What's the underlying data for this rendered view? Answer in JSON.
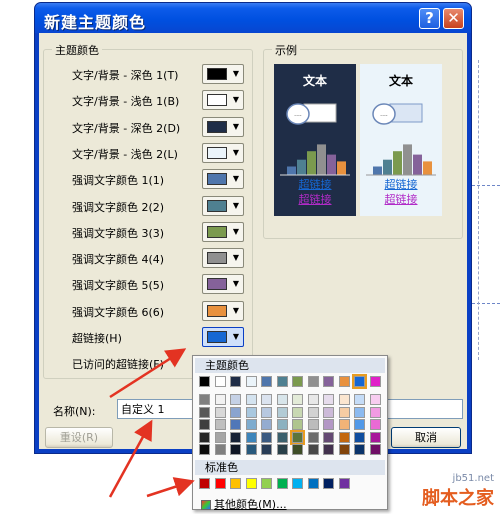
{
  "window": {
    "title": "新建主题颜色",
    "help_glyph": "?",
    "close_glyph": "✕"
  },
  "theme_colors": {
    "group_label": "主题颜色",
    "rows": [
      {
        "label": "文字/背景 - 深色 1(T)",
        "color": "#000000"
      },
      {
        "label": "文字/背景 - 浅色 1(B)",
        "color": "#ffffff"
      },
      {
        "label": "文字/背景 - 深色 2(D)",
        "color": "#1f2d47"
      },
      {
        "label": "文字/背景 - 浅色 2(L)",
        "color": "#ebf4fa"
      },
      {
        "label": "强调文字颜色 1(1)",
        "color": "#4f76ac"
      },
      {
        "label": "强调文字颜色 2(2)",
        "color": "#4f8091"
      },
      {
        "label": "强调文字颜色 3(3)",
        "color": "#7b9a4e"
      },
      {
        "label": "强调文字颜色 4(4)",
        "color": "#909090"
      },
      {
        "label": "强调文字颜色 5(5)",
        "color": "#85629a"
      },
      {
        "label": "强调文字颜色 6(6)",
        "color": "#e8913e"
      },
      {
        "label": "超链接(H)",
        "color": "#1667d3"
      },
      {
        "label": "已访问的超链接(F)",
        "color": "#b12bc7"
      }
    ]
  },
  "sample": {
    "group_label": "示例",
    "text_label": "文本",
    "link_label": "超链接",
    "visited_label": "超链接"
  },
  "name_field": {
    "label": "名称(N):",
    "value": "自定义 1"
  },
  "buttons": {
    "reset": "重设(R)",
    "cancel": "取消"
  },
  "picker": {
    "theme_header": "主题颜色",
    "standard_header": "标准色",
    "more_colors": "其他颜色(M)...",
    "theme_top_row": [
      "#000000",
      "#ffffff",
      "#1f2d47",
      "#ebf4fa",
      "#4f76ac",
      "#4f8091",
      "#7b9a4e",
      "#909090",
      "#85629a",
      "#e8913e",
      "#1667d3",
      "#e020c8"
    ],
    "theme_shades": [
      [
        "#7f7f7f",
        "#f2f2f2",
        "#c5d1e6",
        "#d4e3ef",
        "#dbe3ef",
        "#d8e5ea",
        "#e3ebd8",
        "#e8e8e8",
        "#e6dcec",
        "#fbe6d0",
        "#c5dcf7",
        "#f8cdf0"
      ],
      [
        "#595959",
        "#d8d8d8",
        "#8aa4cf",
        "#a9c8df",
        "#b7c8e0",
        "#b2cbd5",
        "#c8d8b3",
        "#d2d2d2",
        "#ccbad8",
        "#f6cca3",
        "#8cbaf0",
        "#f19be2"
      ],
      [
        "#3f3f3f",
        "#bfbfbf",
        "#5077b8",
        "#7eaccf",
        "#94acd0",
        "#8cb1c0",
        "#afc58e",
        "#bcbcbc",
        "#b397c5",
        "#f2b377",
        "#5299e8",
        "#ea6ad4"
      ],
      [
        "#262626",
        "#a5a5a5",
        "#172236",
        "#3d85bb",
        "#3b5a81",
        "#3b606d",
        "#5c743b",
        "#6c6c6c",
        "#644973",
        "#c3670e",
        "#0f4d9f",
        "#a8179a"
      ],
      [
        "#0c0c0c",
        "#7f7f7f",
        "#0f1624",
        "#28597c",
        "#283c56",
        "#283f48",
        "#3e4d27",
        "#484848",
        "#42314d",
        "#82440a",
        "#0a336a",
        "#700f66"
      ]
    ],
    "selected_shade": {
      "row": 3,
      "col": 6
    },
    "standard_row": [
      "#c00000",
      "#ff0000",
      "#ffc000",
      "#ffff00",
      "#92d050",
      "#00b050",
      "#00b0f0",
      "#0070c0",
      "#002060",
      "#7030a0"
    ]
  },
  "chart_bars": {
    "dark": [
      "#4f76ac",
      "#4f8091",
      "#7b9a4e",
      "#909090",
      "#85629a",
      "#e8913e"
    ],
    "light": [
      "#4f76ac",
      "#4f8091",
      "#7b9a4e",
      "#909090",
      "#85629a",
      "#e8913e"
    ],
    "values": [
      0.25,
      0.45,
      0.7,
      0.9,
      0.6,
      0.4
    ]
  },
  "watermark": {
    "site": "jb51.net",
    "brand": "脚本之家"
  },
  "colors": {
    "arrow": "#e33322",
    "title_bar": "#0050e0",
    "dialog_bg": "#ece9d8"
  }
}
